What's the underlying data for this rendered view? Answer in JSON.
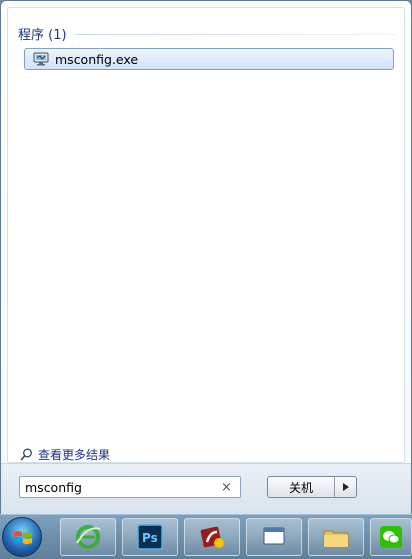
{
  "results": {
    "group_label": "程序 (1)",
    "items": [
      {
        "label": "msconfig.exe",
        "icon": "msconfig-monitor-icon"
      }
    ],
    "see_more_label": "查看更多结果"
  },
  "search": {
    "value": "msconfig",
    "clear_label": "×"
  },
  "shutdown": {
    "label": "关机",
    "menu_icon": "triangle-right-icon"
  },
  "taskbar": {
    "start_icon": "windows-orb-icon",
    "pinned": [
      {
        "name": "ie",
        "icon": "internet-explorer-icon"
      },
      {
        "name": "photoshop",
        "icon": "photoshop-icon",
        "text": "Ps"
      },
      {
        "name": "flash",
        "icon": "flash-icon"
      },
      {
        "name": "app",
        "icon": "application-icon"
      },
      {
        "name": "explorer",
        "icon": "folder-icon"
      },
      {
        "name": "wechat",
        "icon": "chat-icon"
      }
    ]
  },
  "colors": {
    "group_text": "#1e3287",
    "selection_border": "#7da2ce",
    "taskbar": "#6f8fa8"
  }
}
